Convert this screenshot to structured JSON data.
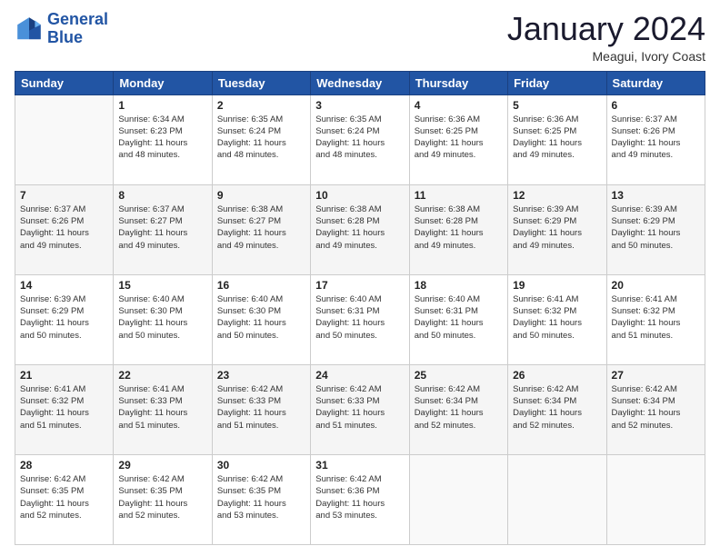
{
  "header": {
    "logo_line1": "General",
    "logo_line2": "Blue",
    "month": "January 2024",
    "location": "Meagui, Ivory Coast"
  },
  "weekdays": [
    "Sunday",
    "Monday",
    "Tuesday",
    "Wednesday",
    "Thursday",
    "Friday",
    "Saturday"
  ],
  "weeks": [
    [
      {
        "day": "",
        "info": ""
      },
      {
        "day": "1",
        "info": "Sunrise: 6:34 AM\nSunset: 6:23 PM\nDaylight: 11 hours\nand 48 minutes."
      },
      {
        "day": "2",
        "info": "Sunrise: 6:35 AM\nSunset: 6:24 PM\nDaylight: 11 hours\nand 48 minutes."
      },
      {
        "day": "3",
        "info": "Sunrise: 6:35 AM\nSunset: 6:24 PM\nDaylight: 11 hours\nand 48 minutes."
      },
      {
        "day": "4",
        "info": "Sunrise: 6:36 AM\nSunset: 6:25 PM\nDaylight: 11 hours\nand 49 minutes."
      },
      {
        "day": "5",
        "info": "Sunrise: 6:36 AM\nSunset: 6:25 PM\nDaylight: 11 hours\nand 49 minutes."
      },
      {
        "day": "6",
        "info": "Sunrise: 6:37 AM\nSunset: 6:26 PM\nDaylight: 11 hours\nand 49 minutes."
      }
    ],
    [
      {
        "day": "7",
        "info": "Sunrise: 6:37 AM\nSunset: 6:26 PM\nDaylight: 11 hours\nand 49 minutes."
      },
      {
        "day": "8",
        "info": "Sunrise: 6:37 AM\nSunset: 6:27 PM\nDaylight: 11 hours\nand 49 minutes."
      },
      {
        "day": "9",
        "info": "Sunrise: 6:38 AM\nSunset: 6:27 PM\nDaylight: 11 hours\nand 49 minutes."
      },
      {
        "day": "10",
        "info": "Sunrise: 6:38 AM\nSunset: 6:28 PM\nDaylight: 11 hours\nand 49 minutes."
      },
      {
        "day": "11",
        "info": "Sunrise: 6:38 AM\nSunset: 6:28 PM\nDaylight: 11 hours\nand 49 minutes."
      },
      {
        "day": "12",
        "info": "Sunrise: 6:39 AM\nSunset: 6:29 PM\nDaylight: 11 hours\nand 49 minutes."
      },
      {
        "day": "13",
        "info": "Sunrise: 6:39 AM\nSunset: 6:29 PM\nDaylight: 11 hours\nand 50 minutes."
      }
    ],
    [
      {
        "day": "14",
        "info": "Sunrise: 6:39 AM\nSunset: 6:29 PM\nDaylight: 11 hours\nand 50 minutes."
      },
      {
        "day": "15",
        "info": "Sunrise: 6:40 AM\nSunset: 6:30 PM\nDaylight: 11 hours\nand 50 minutes."
      },
      {
        "day": "16",
        "info": "Sunrise: 6:40 AM\nSunset: 6:30 PM\nDaylight: 11 hours\nand 50 minutes."
      },
      {
        "day": "17",
        "info": "Sunrise: 6:40 AM\nSunset: 6:31 PM\nDaylight: 11 hours\nand 50 minutes."
      },
      {
        "day": "18",
        "info": "Sunrise: 6:40 AM\nSunset: 6:31 PM\nDaylight: 11 hours\nand 50 minutes."
      },
      {
        "day": "19",
        "info": "Sunrise: 6:41 AM\nSunset: 6:32 PM\nDaylight: 11 hours\nand 50 minutes."
      },
      {
        "day": "20",
        "info": "Sunrise: 6:41 AM\nSunset: 6:32 PM\nDaylight: 11 hours\nand 51 minutes."
      }
    ],
    [
      {
        "day": "21",
        "info": "Sunrise: 6:41 AM\nSunset: 6:32 PM\nDaylight: 11 hours\nand 51 minutes."
      },
      {
        "day": "22",
        "info": "Sunrise: 6:41 AM\nSunset: 6:33 PM\nDaylight: 11 hours\nand 51 minutes."
      },
      {
        "day": "23",
        "info": "Sunrise: 6:42 AM\nSunset: 6:33 PM\nDaylight: 11 hours\nand 51 minutes."
      },
      {
        "day": "24",
        "info": "Sunrise: 6:42 AM\nSunset: 6:33 PM\nDaylight: 11 hours\nand 51 minutes."
      },
      {
        "day": "25",
        "info": "Sunrise: 6:42 AM\nSunset: 6:34 PM\nDaylight: 11 hours\nand 52 minutes."
      },
      {
        "day": "26",
        "info": "Sunrise: 6:42 AM\nSunset: 6:34 PM\nDaylight: 11 hours\nand 52 minutes."
      },
      {
        "day": "27",
        "info": "Sunrise: 6:42 AM\nSunset: 6:34 PM\nDaylight: 11 hours\nand 52 minutes."
      }
    ],
    [
      {
        "day": "28",
        "info": "Sunrise: 6:42 AM\nSunset: 6:35 PM\nDaylight: 11 hours\nand 52 minutes."
      },
      {
        "day": "29",
        "info": "Sunrise: 6:42 AM\nSunset: 6:35 PM\nDaylight: 11 hours\nand 52 minutes."
      },
      {
        "day": "30",
        "info": "Sunrise: 6:42 AM\nSunset: 6:35 PM\nDaylight: 11 hours\nand 53 minutes."
      },
      {
        "day": "31",
        "info": "Sunrise: 6:42 AM\nSunset: 6:36 PM\nDaylight: 11 hours\nand 53 minutes."
      },
      {
        "day": "",
        "info": ""
      },
      {
        "day": "",
        "info": ""
      },
      {
        "day": "",
        "info": ""
      }
    ]
  ]
}
